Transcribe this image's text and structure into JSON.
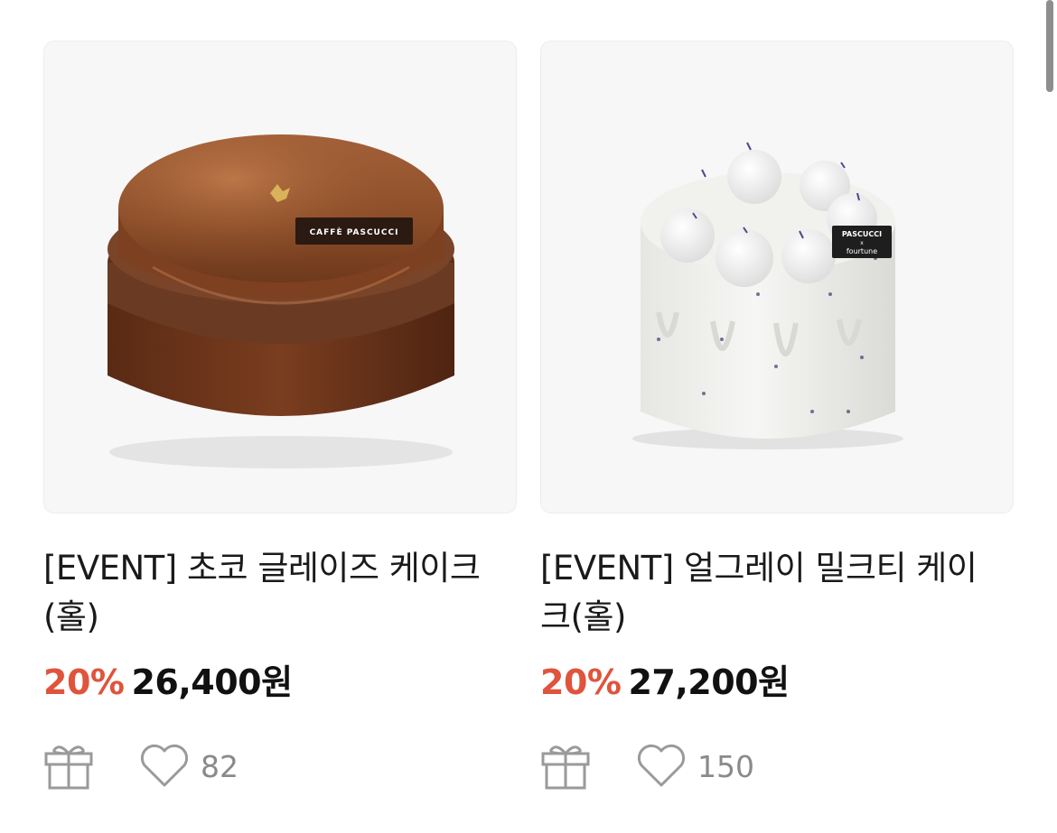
{
  "products": [
    {
      "image_icon": "choco-glaze-cake-image",
      "image_label": "CAFFÈ PASCUCCI",
      "title": "[EVENT] 초코 글레이즈 케이크(홀)",
      "discount": "20%",
      "price": "26,400원",
      "likes": "82",
      "gift_icon": "gift-icon",
      "like_icon": "heart-icon"
    },
    {
      "image_icon": "earl-grey-milk-tea-cake-image",
      "image_label_1": "PASCUCCI",
      "image_label_2": "x",
      "image_label_3": "fourtune",
      "title": "[EVENT] 얼그레이 밀크티 케이크(홀)",
      "discount": "20%",
      "price": "27,200원",
      "likes": "150",
      "gift_icon": "gift-icon",
      "like_icon": "heart-icon"
    }
  ],
  "colors": {
    "discount": "#e0533c",
    "price": "#111111",
    "title": "#1a1a1a",
    "icon": "#9a9a9a",
    "card_bg": "#f7f7f7"
  }
}
